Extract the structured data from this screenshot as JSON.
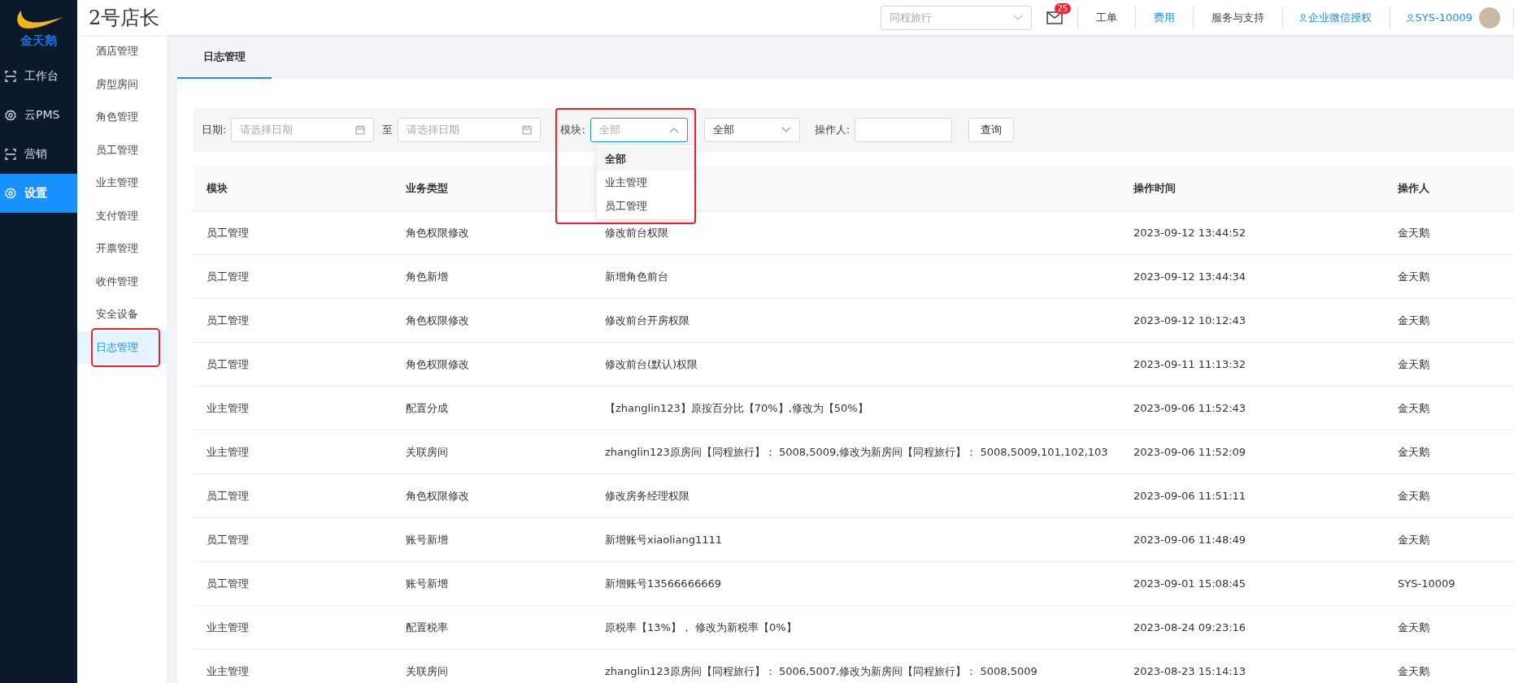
{
  "brand": {
    "name": "金天鹅",
    "store": "2号店长"
  },
  "topbar": {
    "hotel_select": {
      "placeholder": "同程旅行"
    },
    "mail_badge": "25",
    "links": [
      {
        "label": "工单",
        "highlight": false
      },
      {
        "label": "费用",
        "highlight": true
      },
      {
        "label": "服务与支持",
        "highlight": false
      }
    ],
    "wechat": "企业微信授权",
    "user": "SYS-10009"
  },
  "nav": [
    {
      "label": "工作台",
      "kind": "scan",
      "selected": false
    },
    {
      "label": "云PMS",
      "kind": "gear",
      "selected": false
    },
    {
      "label": "营销",
      "kind": "scan",
      "selected": false
    },
    {
      "label": "设置",
      "kind": "gear",
      "selected": true
    }
  ],
  "submenu": [
    {
      "label": "酒店管理",
      "selected": false
    },
    {
      "label": "房型房间",
      "selected": false
    },
    {
      "label": "角色管理",
      "selected": false
    },
    {
      "label": "员工管理",
      "selected": false
    },
    {
      "label": "业主管理",
      "selected": false
    },
    {
      "label": "支付管理",
      "selected": false
    },
    {
      "label": "开票管理",
      "selected": false
    },
    {
      "label": "收件管理",
      "selected": false
    },
    {
      "label": "安全设备",
      "selected": false
    },
    {
      "label": "日志管理",
      "selected": true
    }
  ],
  "tabs": [
    {
      "label": "日志管理",
      "selected": true
    }
  ],
  "filters": {
    "date_label": "日期:",
    "date_from": {
      "placeholder": "请选择日期"
    },
    "to": "至",
    "date_to": {
      "placeholder": "请选择日期"
    },
    "module_label": "模块:",
    "module_select": {
      "placeholder": "全部",
      "expanded": true,
      "options": [
        {
          "label": "全部",
          "selected": true
        },
        {
          "label": "业主管理",
          "selected": false
        },
        {
          "label": "员工管理",
          "selected": false
        }
      ]
    },
    "type_select": {
      "value": "全部"
    },
    "operator_label": "操作人:",
    "query_button": "查询"
  },
  "table": {
    "headers": {
      "module": "模块",
      "type": "业务类型",
      "time": "操作时间",
      "operator": "操作人"
    },
    "rows": [
      {
        "module": "员工管理",
        "type": "角色权限修改",
        "content": "修改前台权限",
        "time": "2023-09-12 13:44:52",
        "operator": "金天鹅"
      },
      {
        "module": "员工管理",
        "type": "角色新增",
        "content": "新增角色前台",
        "time": "2023-09-12 13:44:34",
        "operator": "金天鹅"
      },
      {
        "module": "员工管理",
        "type": "角色权限修改",
        "content": "修改前台开房权限",
        "time": "2023-09-12 10:12:43",
        "operator": "金天鹅"
      },
      {
        "module": "员工管理",
        "type": "角色权限修改",
        "content": "修改前台(默认)权限",
        "time": "2023-09-11 11:13:32",
        "operator": "金天鹅"
      },
      {
        "module": "业主管理",
        "type": "配置分成",
        "content": "【zhanglin123】原按百分比【70%】,修改为【50%】",
        "time": "2023-09-06 11:52:43",
        "operator": "金天鹅"
      },
      {
        "module": "业主管理",
        "type": "关联房间",
        "content": "zhanglin123原房间【同程旅行】： 5008,5009,修改为新房间【同程旅行】： 5008,5009,101,102,103",
        "time": "2023-09-06 11:52:09",
        "operator": "金天鹅"
      },
      {
        "module": "员工管理",
        "type": "角色权限修改",
        "content": "修改房务经理权限",
        "time": "2023-09-06 11:51:11",
        "operator": "金天鹅"
      },
      {
        "module": "员工管理",
        "type": "账号新增",
        "content": "新增账号xiaoliang1111",
        "time": "2023-09-06 11:48:49",
        "operator": "金天鹅"
      },
      {
        "module": "员工管理",
        "type": "账号新增",
        "content": "新增账号13566666669",
        "time": "2023-09-01 15:08:45",
        "operator": "SYS-10009"
      },
      {
        "module": "业主管理",
        "type": "配置税率",
        "content": "原税率【13%】， 修改为新税率【0%】",
        "time": "2023-08-24 09:23:16",
        "operator": "金天鹅"
      },
      {
        "module": "业主管理",
        "type": "关联房间",
        "content": "zhanglin123原房间【同程旅行】： 5006,5007,修改为新房间【同程旅行】： 5008,5009",
        "time": "2023-08-23 15:14:13",
        "operator": "金天鹅"
      }
    ]
  }
}
